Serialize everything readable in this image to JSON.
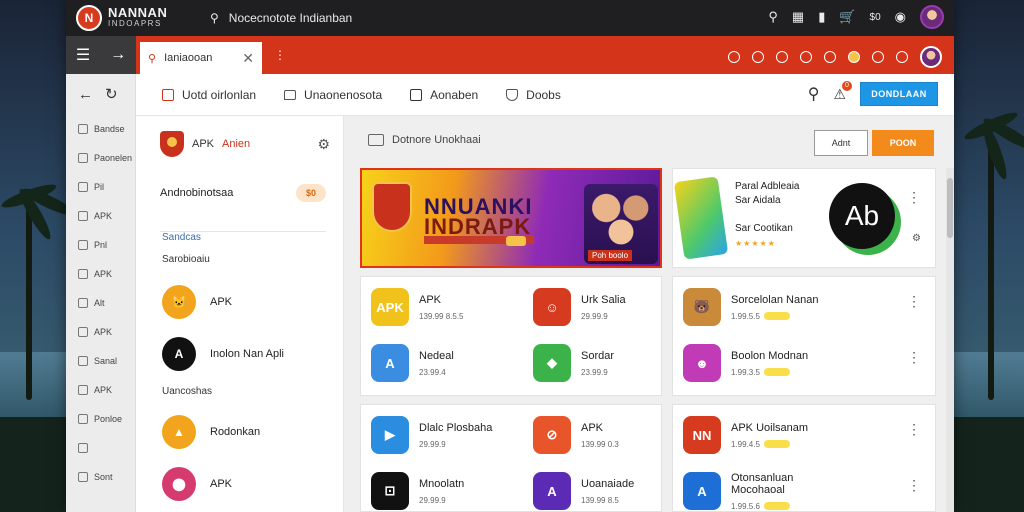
{
  "brand": {
    "logo_text": "NANNAN",
    "logo_sub": "INDOAPRS",
    "logo_initials": "N"
  },
  "top_search": {
    "text": "Nocecnotote Indianban"
  },
  "top_bar": {
    "cart_label": "$0"
  },
  "navbar": {
    "tab_label": "Ianiaooan"
  },
  "strip": {
    "items": [
      "Bandse",
      "Paonelen",
      "Pil",
      "APK",
      "Pnl",
      "APK",
      "Alt",
      "APK",
      "Sanal",
      "APK",
      "Ponloe",
      "",
      "Sont"
    ]
  },
  "inner_tabs": [
    {
      "label": "Uotd oirlonlan"
    },
    {
      "label": "Unaonenosota"
    },
    {
      "label": "Aonaben"
    },
    {
      "label": "Doobs"
    }
  ],
  "inner_bar": {
    "button_label": "DONDLAAN",
    "bell_count": "0"
  },
  "sidebar": {
    "header_title": "APK",
    "header_accent": "Anien",
    "row_label": "Andnobinotsaa",
    "row_badge": "$0",
    "section1": "Sandcas",
    "section1_sub": "Sarobioaiu",
    "section2": "Uancoshas",
    "apps": [
      {
        "label": "APK",
        "icon": "cat-icon",
        "color": "#f2a51c",
        "glyph": "🐱"
      },
      {
        "label": "Inolon Nan Apli",
        "icon": "logo-icon",
        "color": "#111111",
        "glyph": "A"
      },
      {
        "label": "Rodonkan",
        "icon": "arrow-icon",
        "color": "#f2a51c",
        "glyph": "▲"
      },
      {
        "label": "APK",
        "icon": "camera-icon",
        "color": "#d63b6f",
        "glyph": "⬤"
      }
    ]
  },
  "content": {
    "header": "Dotnore Unokhaai",
    "btn_outline": "Adnt",
    "btn_orange": "POON",
    "banner": {
      "line1": "NNUANKI",
      "line2": "INDRAPK",
      "tag": "Poh boolo"
    },
    "promo": {
      "line1": "Paral Adbleaia",
      "line2": "Sar Aidala",
      "line3": "Sar Cootikan",
      "icon_text": "Ab",
      "stars": "★★★★★"
    },
    "card1_apps": [
      {
        "name": "APK",
        "meta": "139.99 8.5.5",
        "color": "#f2c21c",
        "glyph": "APK"
      },
      {
        "name": "Urk Salia",
        "meta": "29.99.9",
        "color": "#d63b1f",
        "glyph": "☺"
      },
      {
        "name": "Nedeal",
        "meta": "23.99.4",
        "color": "#3a8de0",
        "glyph": "A"
      },
      {
        "name": "Sordar",
        "meta": "23.99.9",
        "color": "#3cb24a",
        "glyph": "◆"
      }
    ],
    "card2_apps": [
      {
        "name": "Sorcelolan Nanan",
        "meta": "1.99.5.5",
        "color": "#c98a3a",
        "glyph": "🐻"
      },
      {
        "name": "Boolon Modnan",
        "meta": "1.99.3.5",
        "color": "#c23bb6",
        "glyph": "☻"
      }
    ],
    "card3_apps": [
      {
        "name": "Dlalc Plosbaha",
        "meta": "29.99.9",
        "color": "#2a8de0",
        "glyph": "▶"
      },
      {
        "name": "APK",
        "meta": "139.99 0.3",
        "color": "#e8552a",
        "glyph": "⊘"
      },
      {
        "name": "Mnoolatn",
        "meta": "29.99.9",
        "color": "#111111",
        "glyph": "⊡"
      },
      {
        "name": "Uoanaiade",
        "meta": "139.99 8.5",
        "color": "#5b2bb6",
        "glyph": "A"
      }
    ],
    "card4_apps": [
      {
        "name": "APK Uoilsanam",
        "meta": "1.99.4.5",
        "color": "#d63b1f",
        "glyph": "NN"
      },
      {
        "name": "Otonsanluan Mocohaoal",
        "meta": "1.99.5.6",
        "color": "#1d6fd6",
        "glyph": "A"
      }
    ]
  }
}
